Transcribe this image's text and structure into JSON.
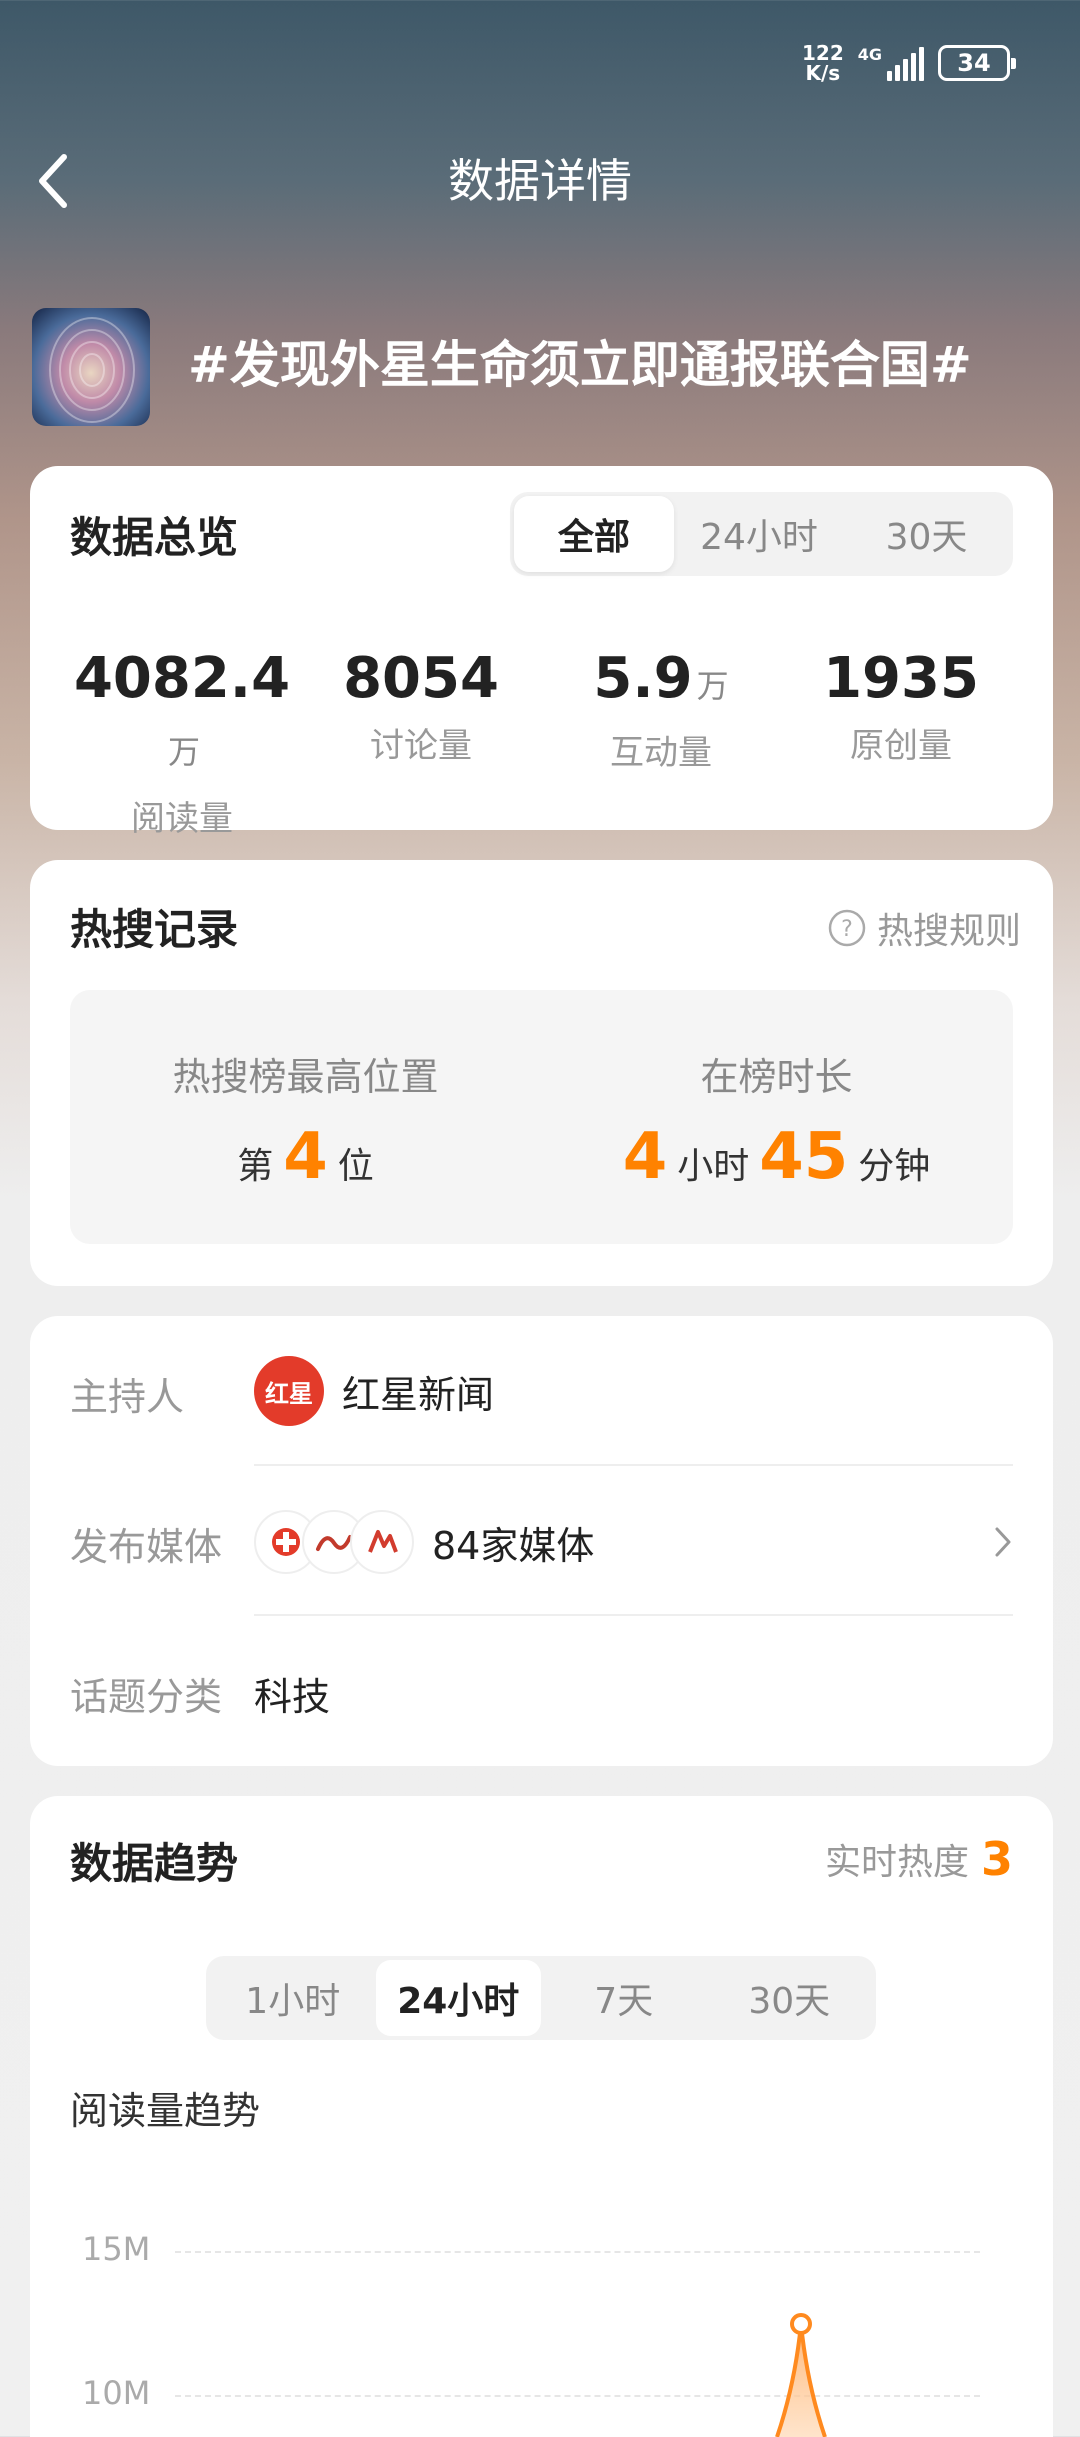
{
  "status_bar": {
    "speed_top": "122",
    "speed_bottom": "K/s",
    "network": "4G",
    "battery": "34"
  },
  "header": {
    "title": "数据详情"
  },
  "topic": {
    "title": "#发现外星生命须立即通报联合国#"
  },
  "overview": {
    "title": "数据总览",
    "tabs": [
      {
        "label": "全部"
      },
      {
        "label": "24小时"
      },
      {
        "label": "30天"
      }
    ],
    "stats": [
      {
        "value": "4082.4",
        "unit": "万",
        "label": "阅读量"
      },
      {
        "value": "8054",
        "unit": "",
        "label": "讨论量"
      },
      {
        "value": "5.9",
        "unit": "万",
        "label": "互动量"
      },
      {
        "value": "1935",
        "unit": "",
        "label": "原创量"
      }
    ]
  },
  "hot_search": {
    "title": "热搜记录",
    "rules_link": "热搜规则",
    "highest_label": "热搜榜最高位置",
    "rank_prefix": "第",
    "rank": "4",
    "rank_suffix": "位",
    "duration_label": "在榜时长",
    "hours": "4",
    "hours_unit": "小时",
    "minutes": "45",
    "minutes_unit": "分钟"
  },
  "info": {
    "host_label": "主持人",
    "host_name": "红星新闻",
    "host_logo_text": "红星",
    "media_label": "发布媒体",
    "media_count": "84家媒体",
    "category_label": "话题分类",
    "category": "科技"
  },
  "trend": {
    "title": "数据趋势",
    "heat_label": "实时热度",
    "heat_value": "3",
    "tabs": [
      {
        "label": "1小时"
      },
      {
        "label": "24小时"
      },
      {
        "label": "7天"
      },
      {
        "label": "30天"
      }
    ],
    "chart_title": "阅读量趋势"
  },
  "chart_data": {
    "type": "line",
    "title": "阅读量趋势",
    "ytick_labels": [
      "15M",
      "10M"
    ],
    "y_ticks": [
      15000000,
      10000000
    ],
    "series": [
      {
        "values": [
          12500000
        ]
      }
    ],
    "colors": {
      "line": "#ff8a1f",
      "accent": "#ff8200"
    }
  }
}
